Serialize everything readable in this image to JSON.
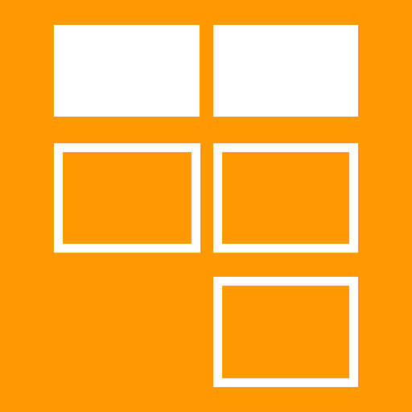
{
  "icon": {
    "name": "tile-grid-icon",
    "background_color": "#FF9900",
    "foreground_color": "#FFFFFF",
    "tiles": [
      {
        "row": 1,
        "col": 1,
        "style": "filled"
      },
      {
        "row": 1,
        "col": 2,
        "style": "filled"
      },
      {
        "row": 2,
        "col": 1,
        "style": "outline"
      },
      {
        "row": 2,
        "col": 2,
        "style": "outline"
      },
      {
        "row": 3,
        "col": 2,
        "style": "outline"
      }
    ]
  }
}
